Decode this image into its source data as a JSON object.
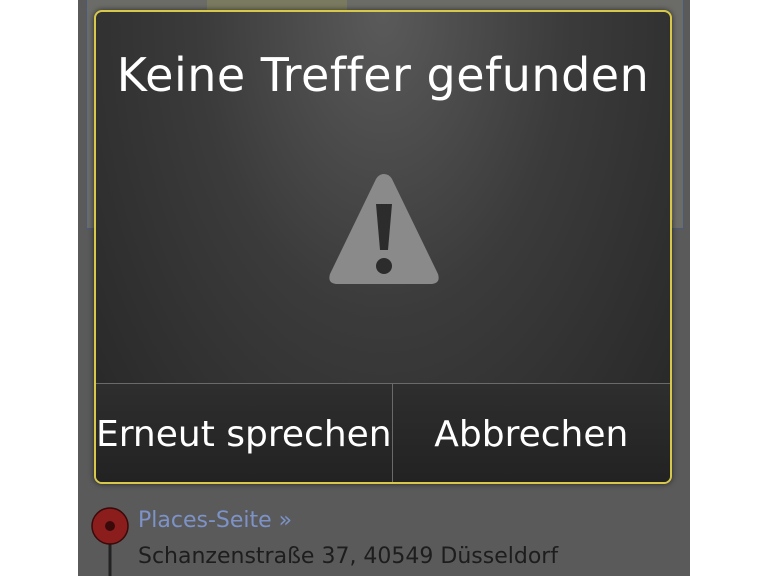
{
  "dialog": {
    "title": "Keine Treffer gefunden",
    "icon": "warning-icon",
    "buttons": {
      "retry_label": "Erneut sprechen",
      "cancel_label": "Abbrechen"
    }
  },
  "place": {
    "link_text": "Places-Seite »",
    "address": "Schanzenstraße 37, 40549 Düsseldorf",
    "pin_icon": "map-pin-icon"
  },
  "colors": {
    "dialog_border": "#d7c84a",
    "link": "#7d93c8",
    "pin": "#8b1d1d"
  }
}
